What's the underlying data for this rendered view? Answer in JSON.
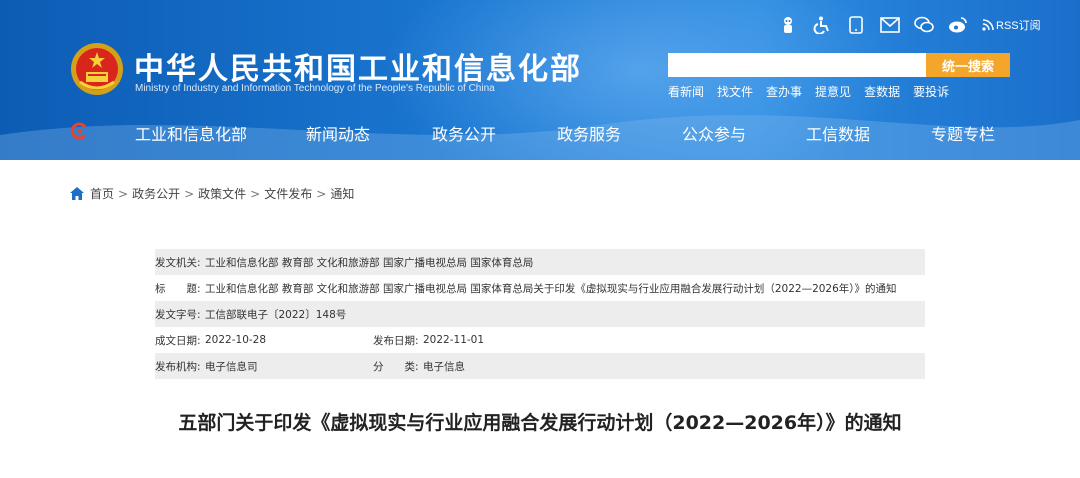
{
  "header": {
    "site_title": "中华人民共和国工业和信息化部",
    "site_subtitle": "Ministry of Industry and Information Technology of the People's Republic of China",
    "rss_label": "RSS订阅",
    "search_placeholder": "",
    "search_button": "统一搜索",
    "quick_links": [
      "看新闻",
      "找文件",
      "查办事",
      "提意见",
      "查数据",
      "要投诉"
    ],
    "toolbar_icons": [
      "mascot-icon",
      "accessibility-icon",
      "mobile-icon",
      "mail-icon",
      "wechat-icon",
      "weibo-icon",
      "rss-icon"
    ]
  },
  "nav": {
    "items": [
      "工业和信息化部",
      "新闻动态",
      "政务公开",
      "政务服务",
      "公众参与",
      "工信数据",
      "专题专栏"
    ]
  },
  "breadcrumb": {
    "items": [
      "首页",
      "政务公开",
      "政策文件",
      "文件发布",
      "通知"
    ],
    "separator": ">"
  },
  "meta": {
    "issuer_label": "发文机关:",
    "issuer": "工业和信息化部 教育部 文化和旅游部 国家广播电视总局 国家体育总局",
    "title_label": "标　　题:",
    "title": "工业和信息化部 教育部 文化和旅游部 国家广播电视总局 国家体育总局关于印发《虚拟现实与行业应用融合发展行动计划（2022—2026年）》的通知",
    "doc_no_label": "发文字号:",
    "doc_no": "工信部联电子〔2022〕148号",
    "created_label": "成文日期:",
    "created": "2022-10-28",
    "published_label": "发布日期:",
    "published": "2022-11-01",
    "org_label": "发布机构:",
    "org": "电子信息司",
    "category_label": "分　　类:",
    "category": "电子信息"
  },
  "document": {
    "title": "五部门关于印发《虚拟现实与行业应用融合发展行动计划（2022—2026年）》的通知"
  },
  "colors": {
    "header_blue": "#1b78d2",
    "search_button": "#f4a62a",
    "meta_shade": "#ededed"
  }
}
